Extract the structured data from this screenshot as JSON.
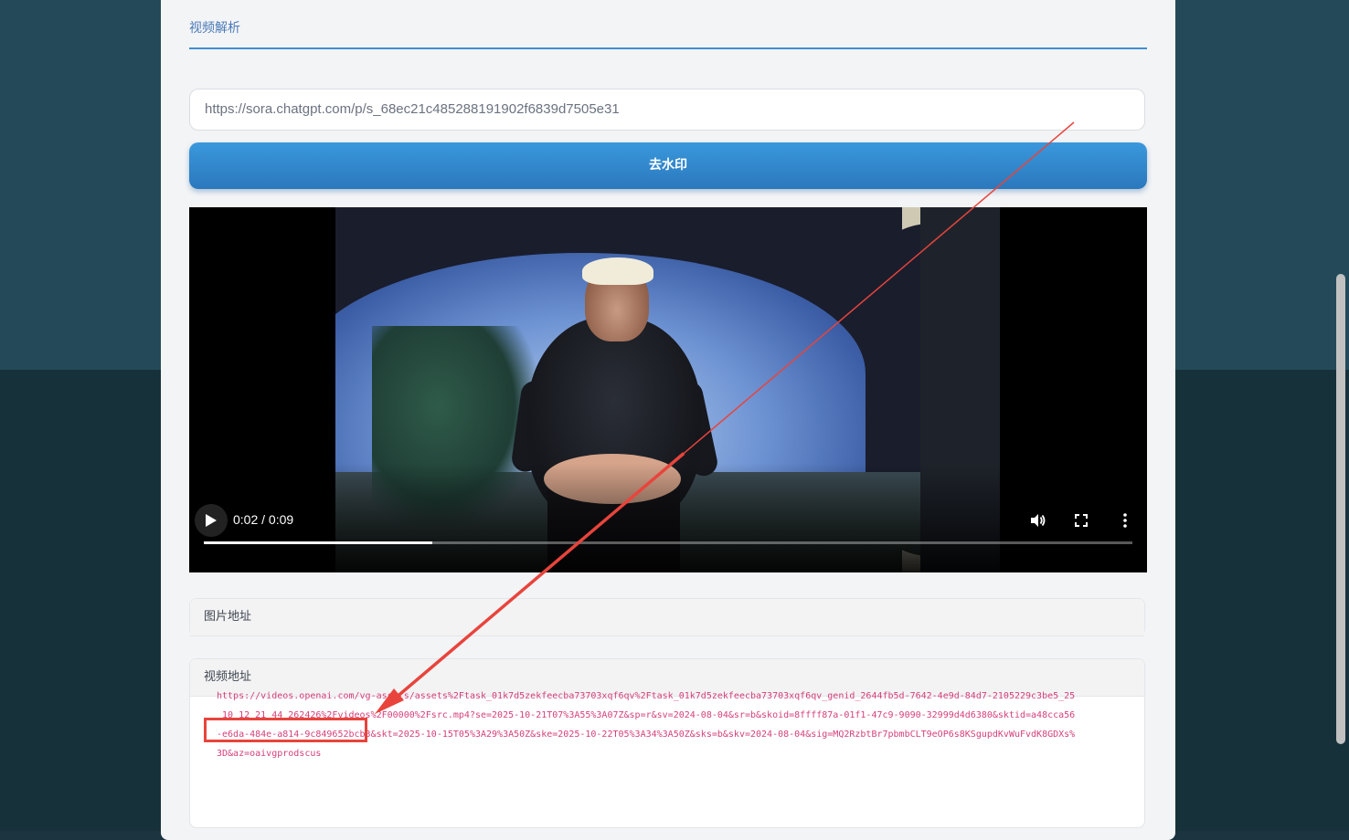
{
  "tab": {
    "label": "视频解析"
  },
  "input": {
    "value": "https://sora.chatgpt.com/p/s_68ec21c485288191902f6839d7505e31"
  },
  "button": {
    "label": "去水印"
  },
  "player": {
    "time": "0:02 / 0:09",
    "progress_fraction": 0.246,
    "icons": [
      "play-icon",
      "volume-icon",
      "fullscreen-icon",
      "more-options-icon"
    ]
  },
  "image_panel": {
    "title": "图片地址"
  },
  "video_panel": {
    "title": "视频地址",
    "url": "https://videos.openai.com/vg-assets/assets%2Ftask_01k7d5zekfeecba73703xqf6qv%2Ftask_01k7d5zekfeecba73703xqf6qv_genid_2644fb5d-7642-4e9d-84d7-2105229c3be5_25_10_12_21_44_262426%2Fvideos%2F00000%2Fsrc.mp4?se=2025-10-21T07%3A55%3A07Z&sp=r&sv=2024-08-04&sr=b&skoid=8ffff87a-01f1-47c9-9090-32999d4d6380&sktid=a48cca56-e6da-484e-a814-9c849652bcb3&skt=2025-10-15T05%3A29%3A50Z&ske=2025-10-22T05%3A34%3A50Z&sks=b&skv=2024-08-04&sig=MQ2RzbtBr7pbmbCLT9eOP6s8KSgupdKvWuFvdK8GDXs%3D&az=oaivgprodscus"
  },
  "colors": {
    "accent": "#3f8dd0",
    "button_top": "#3a98dc",
    "button_bottom": "#2b78bd",
    "link": "#d43f7a",
    "annotation": "#e8443c"
  }
}
